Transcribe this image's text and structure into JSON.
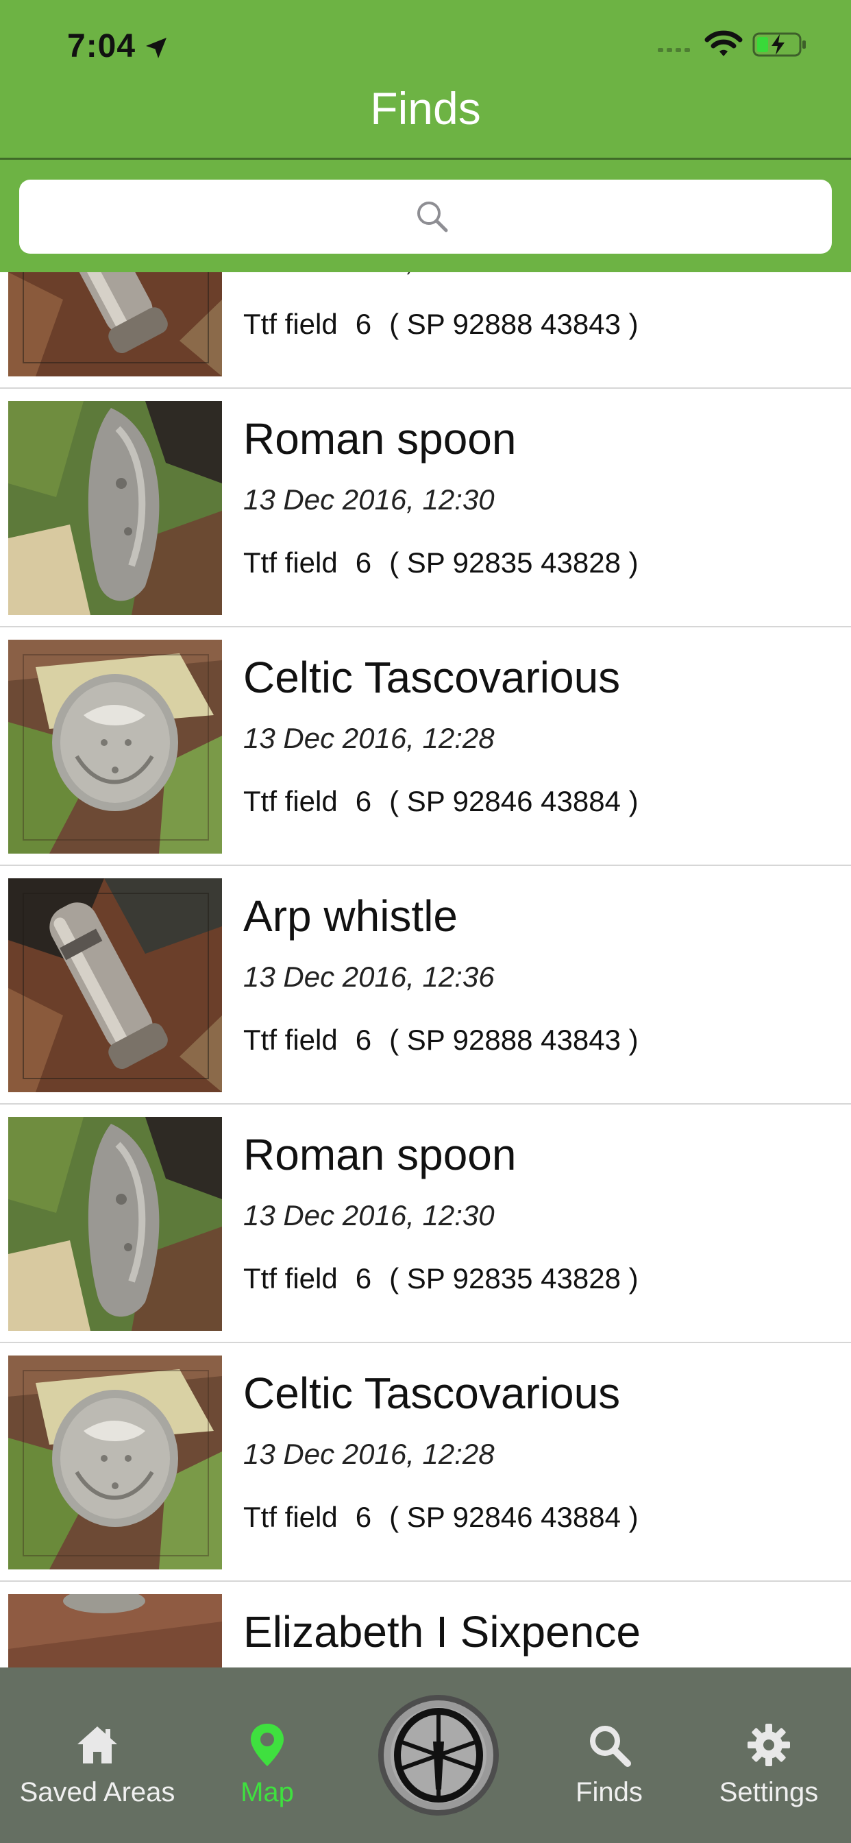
{
  "status_bar": {
    "time": "7:04"
  },
  "header": {
    "title": "Finds",
    "search_placeholder": ""
  },
  "finds": [
    {
      "name": "Arp whistle",
      "date": "13 Dec 2016, 12:36",
      "field": "Ttf field",
      "field_num": "6",
      "grid_ref": "( SP 92888 43843 )",
      "photo": "whistle-photo"
    },
    {
      "name": "Roman spoon",
      "date": "13 Dec 2016, 12:30",
      "field": "Ttf field",
      "field_num": "6",
      "grid_ref": "( SP 92835 43828 )",
      "photo": "spoon-photo"
    },
    {
      "name": "Celtic Tascovarious",
      "date": "13 Dec 2016, 12:28",
      "field": "Ttf field",
      "field_num": "6",
      "grid_ref": "( SP 92846 43884 )",
      "photo": "coin-photo"
    },
    {
      "name": "Arp whistle",
      "date": "13 Dec 2016, 12:36",
      "field": "Ttf field",
      "field_num": "6",
      "grid_ref": "( SP 92888 43843 )",
      "photo": "whistle-photo"
    },
    {
      "name": "Roman spoon",
      "date": "13 Dec 2016, 12:30",
      "field": "Ttf field",
      "field_num": "6",
      "grid_ref": "( SP 92835 43828 )",
      "photo": "spoon-photo"
    },
    {
      "name": "Celtic Tascovarious",
      "date": "13 Dec 2016, 12:28",
      "field": "Ttf field",
      "field_num": "6",
      "grid_ref": "( SP 92846 43884 )",
      "photo": "coin-photo"
    },
    {
      "name": "Elizabeth I Sixpence",
      "date": "",
      "field": "",
      "field_num": "",
      "grid_ref": "",
      "photo": "sixpence-photo"
    }
  ],
  "tabbar": {
    "tabs": [
      {
        "label": "Saved Areas",
        "icon": "home-icon",
        "active": false
      },
      {
        "label": "Map",
        "icon": "map-pin-icon",
        "active": true
      },
      {
        "label": "",
        "icon": "metal-detector-icon",
        "active": false
      },
      {
        "label": "Finds",
        "icon": "search-icon",
        "active": false
      },
      {
        "label": "Settings",
        "icon": "gear-icon",
        "active": false
      }
    ]
  },
  "colors": {
    "header_green": "#6db344",
    "active_tab_green": "#3fe03f",
    "tabbar_bg": "#656f62"
  }
}
